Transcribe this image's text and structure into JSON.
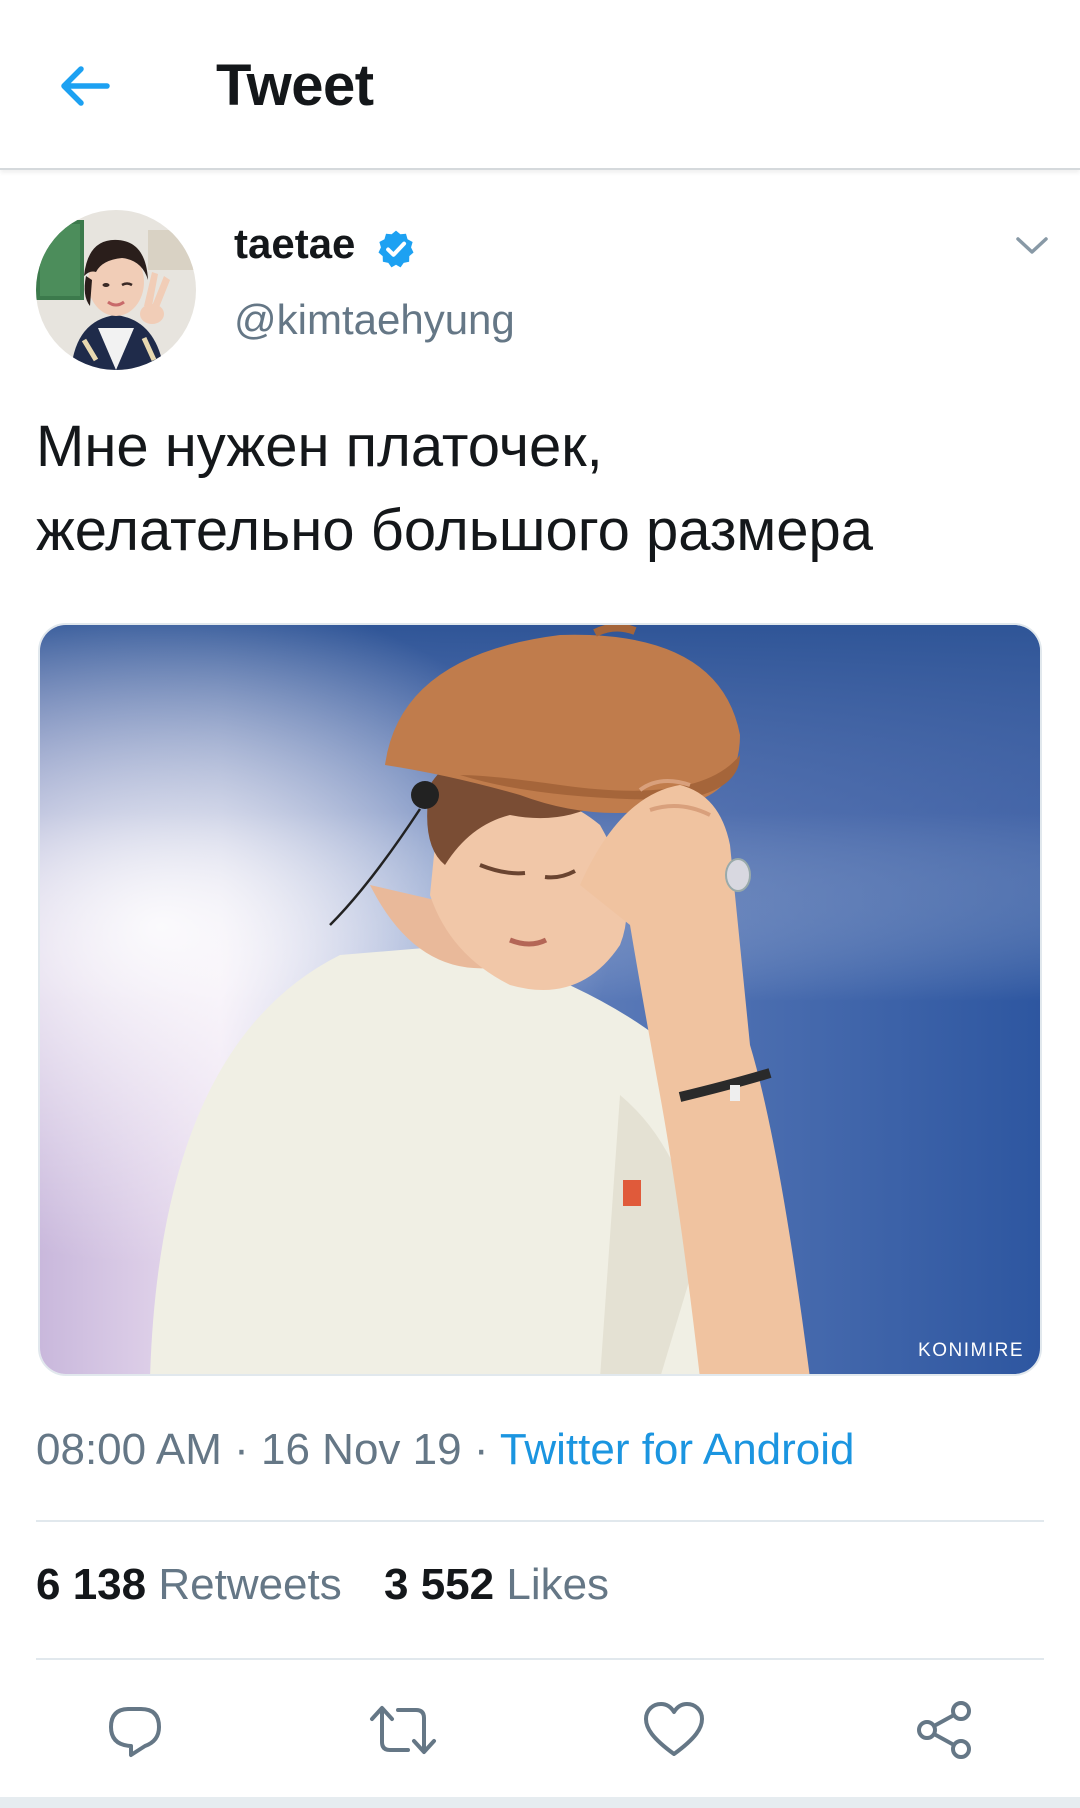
{
  "header": {
    "title": "Tweet",
    "back_icon": "arrow-left-icon",
    "accent_color": "#1da1f2"
  },
  "tweet": {
    "author": {
      "display_name": "taetae",
      "handle": "@kimtaehyung",
      "verified": true,
      "verified_icon": "verified-badge-icon"
    },
    "menu_icon": "chevron-down-icon",
    "text": "Мне нужен платочек,\nжелательно большого размера",
    "media": {
      "watermark": "KONIMIRE"
    },
    "meta": {
      "time": "08:00 AM",
      "separator": " · ",
      "date": "16 Nov 19",
      "source": "Twitter for Android",
      "source_color": "#1b95e0"
    },
    "stats": {
      "retweets_count": "6 138",
      "retweets_label": "Retweets",
      "likes_count": "3 552",
      "likes_label": "Likes"
    },
    "actions": {
      "reply_icon": "reply-icon",
      "retweet_icon": "retweet-icon",
      "like_icon": "heart-icon",
      "share_icon": "share-icon"
    }
  }
}
